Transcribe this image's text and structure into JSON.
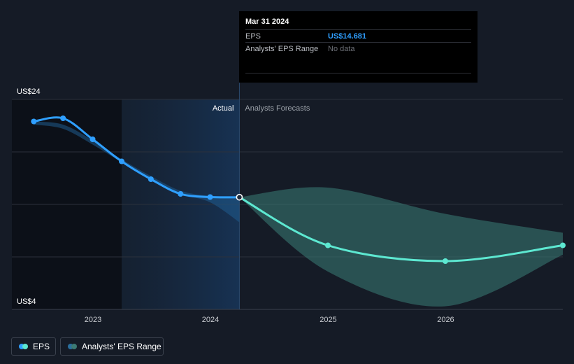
{
  "chart_data": {
    "type": "line",
    "y_axis": {
      "min_label": "US$4",
      "max_label": "US$24",
      "ylim": [
        4,
        24
      ]
    },
    "x_ticks": [
      "2023",
      "2024",
      "2025",
      "2026"
    ],
    "region_labels": {
      "actual": "Actual",
      "forecast": "Analysts Forecasts"
    },
    "series": [
      {
        "name": "EPS",
        "color": "#2f9fff",
        "points": [
          [
            "2022-07-01",
            21.9
          ],
          [
            "2022-09-30",
            22.2
          ],
          [
            "2022-12-31",
            20.2
          ],
          [
            "2023-03-31",
            18.1
          ],
          [
            "2023-06-30",
            16.4
          ],
          [
            "2023-09-30",
            15.0
          ],
          [
            "2023-12-31",
            14.7
          ],
          [
            "2024-03-31",
            14.681
          ]
        ]
      },
      {
        "name": "EPS",
        "color": "#5de8d1",
        "points": [
          [
            "2024-03-31",
            14.681
          ],
          [
            "2024-12-31",
            10.1
          ],
          [
            "2025-12-31",
            8.6
          ],
          [
            "2026-12-31",
            10.1
          ]
        ]
      }
    ],
    "range_band": {
      "name": "Analysts' EPS Range",
      "upper": [
        [
          "2024-03-31",
          14.681
        ],
        [
          "2024-12-31",
          15.6
        ],
        [
          "2025-12-31",
          13.1
        ],
        [
          "2026-12-31",
          11.3
        ]
      ],
      "lower": [
        [
          "2024-03-31",
          14.681
        ],
        [
          "2024-12-31",
          7.6
        ],
        [
          "2025-12-31",
          4.3
        ],
        [
          "2026-12-31",
          9.2
        ]
      ]
    },
    "past_range_band": {
      "upper": [
        [
          "2022-07-01",
          21.9
        ],
        [
          "2022-09-30",
          21.6
        ],
        [
          "2022-12-31",
          20.1
        ],
        [
          "2023-03-31",
          18.3
        ],
        [
          "2023-06-30",
          16.7
        ],
        [
          "2023-09-30",
          15.3
        ],
        [
          "2023-12-31",
          14.8
        ],
        [
          "2024-03-31",
          14.681
        ]
      ],
      "lower": [
        [
          "2022-07-01",
          21.6
        ],
        [
          "2022-09-30",
          21.2
        ],
        [
          "2022-12-31",
          19.7
        ],
        [
          "2023-03-31",
          18.0
        ],
        [
          "2023-06-30",
          16.4
        ],
        [
          "2023-09-30",
          15.0
        ],
        [
          "2023-12-31",
          14.2
        ],
        [
          "2024-03-31",
          12.3
        ]
      ]
    },
    "grid": true
  },
  "tooltip": {
    "date": "Mar 31 2024",
    "eps_label": "EPS",
    "eps_value": "US$14.681",
    "range_label": "Analysts' EPS Range",
    "range_value": "No data"
  },
  "legend": [
    {
      "label": "EPS",
      "colors": [
        "#2f9fff",
        "#5de8d1"
      ]
    },
    {
      "label": "Analysts' EPS Range",
      "colors": [
        "#2a6f9e",
        "#3c7a74"
      ]
    }
  ],
  "colors": {
    "background": "#151b26",
    "past_shade": "#0c1018",
    "actual_shade": "#15263b",
    "grid": "#2b313c"
  }
}
